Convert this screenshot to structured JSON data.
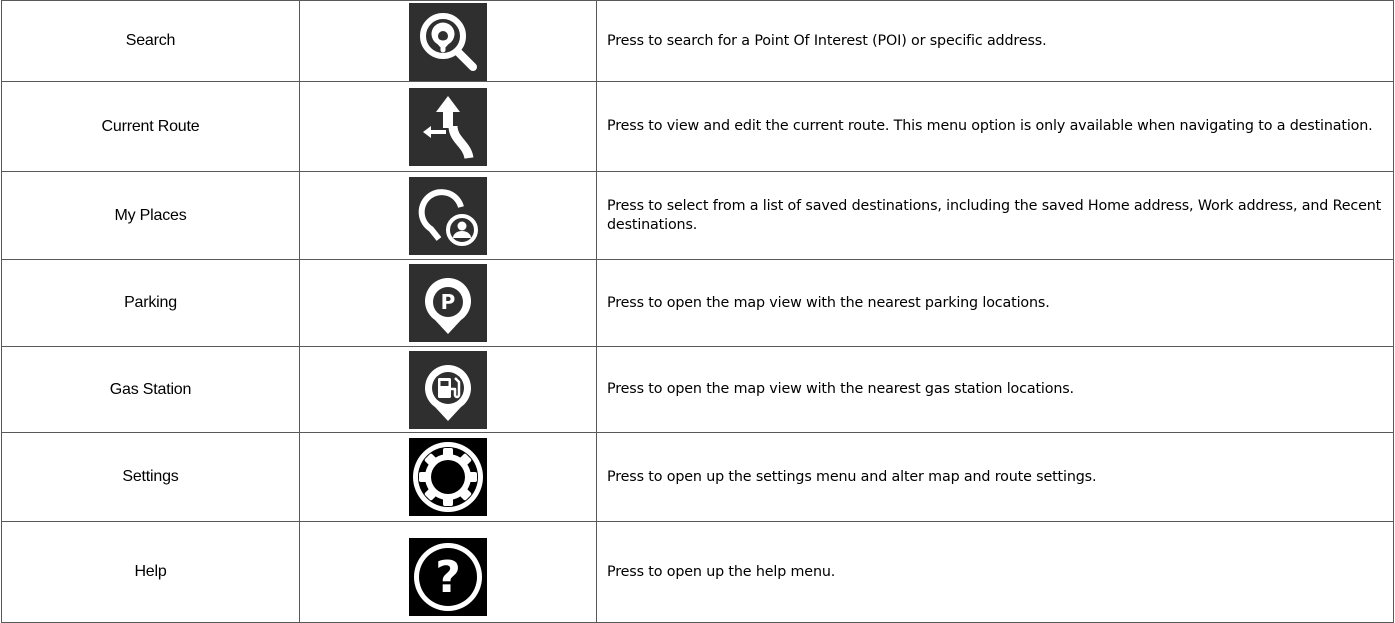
{
  "rows": [
    {
      "name": "Search",
      "icon": "search-poi-icon",
      "description": "Press to search for a Point Of Interest (POI) or specific address."
    },
    {
      "name": "Current Route",
      "icon": "current-route-icon",
      "description": "Press to view and edit the current route. This menu option is only available when navigating to a destination."
    },
    {
      "name": "My Places",
      "icon": "my-places-icon",
      "description": "Press to select from a list of saved destinations, including the saved Home address, Work address, and Recent destinations."
    },
    {
      "name": "Parking",
      "icon": "parking-icon",
      "description": "Press to open the map view with the nearest parking locations."
    },
    {
      "name": "Gas Station",
      "icon": "gas-station-icon",
      "description": "Press to open the map view with the nearest gas station locations."
    },
    {
      "name": "Settings",
      "icon": "settings-gear-icon",
      "description": "Press to open up the settings menu and alter map and route settings."
    },
    {
      "name": "Help",
      "icon": "help-question-icon",
      "description": "Press to open up the help menu."
    }
  ],
  "colors": {
    "icon_background": "#2f2f2f",
    "icon_background_dark": "#000000",
    "icon_foreground": "#ffffff",
    "border": "#595959"
  }
}
